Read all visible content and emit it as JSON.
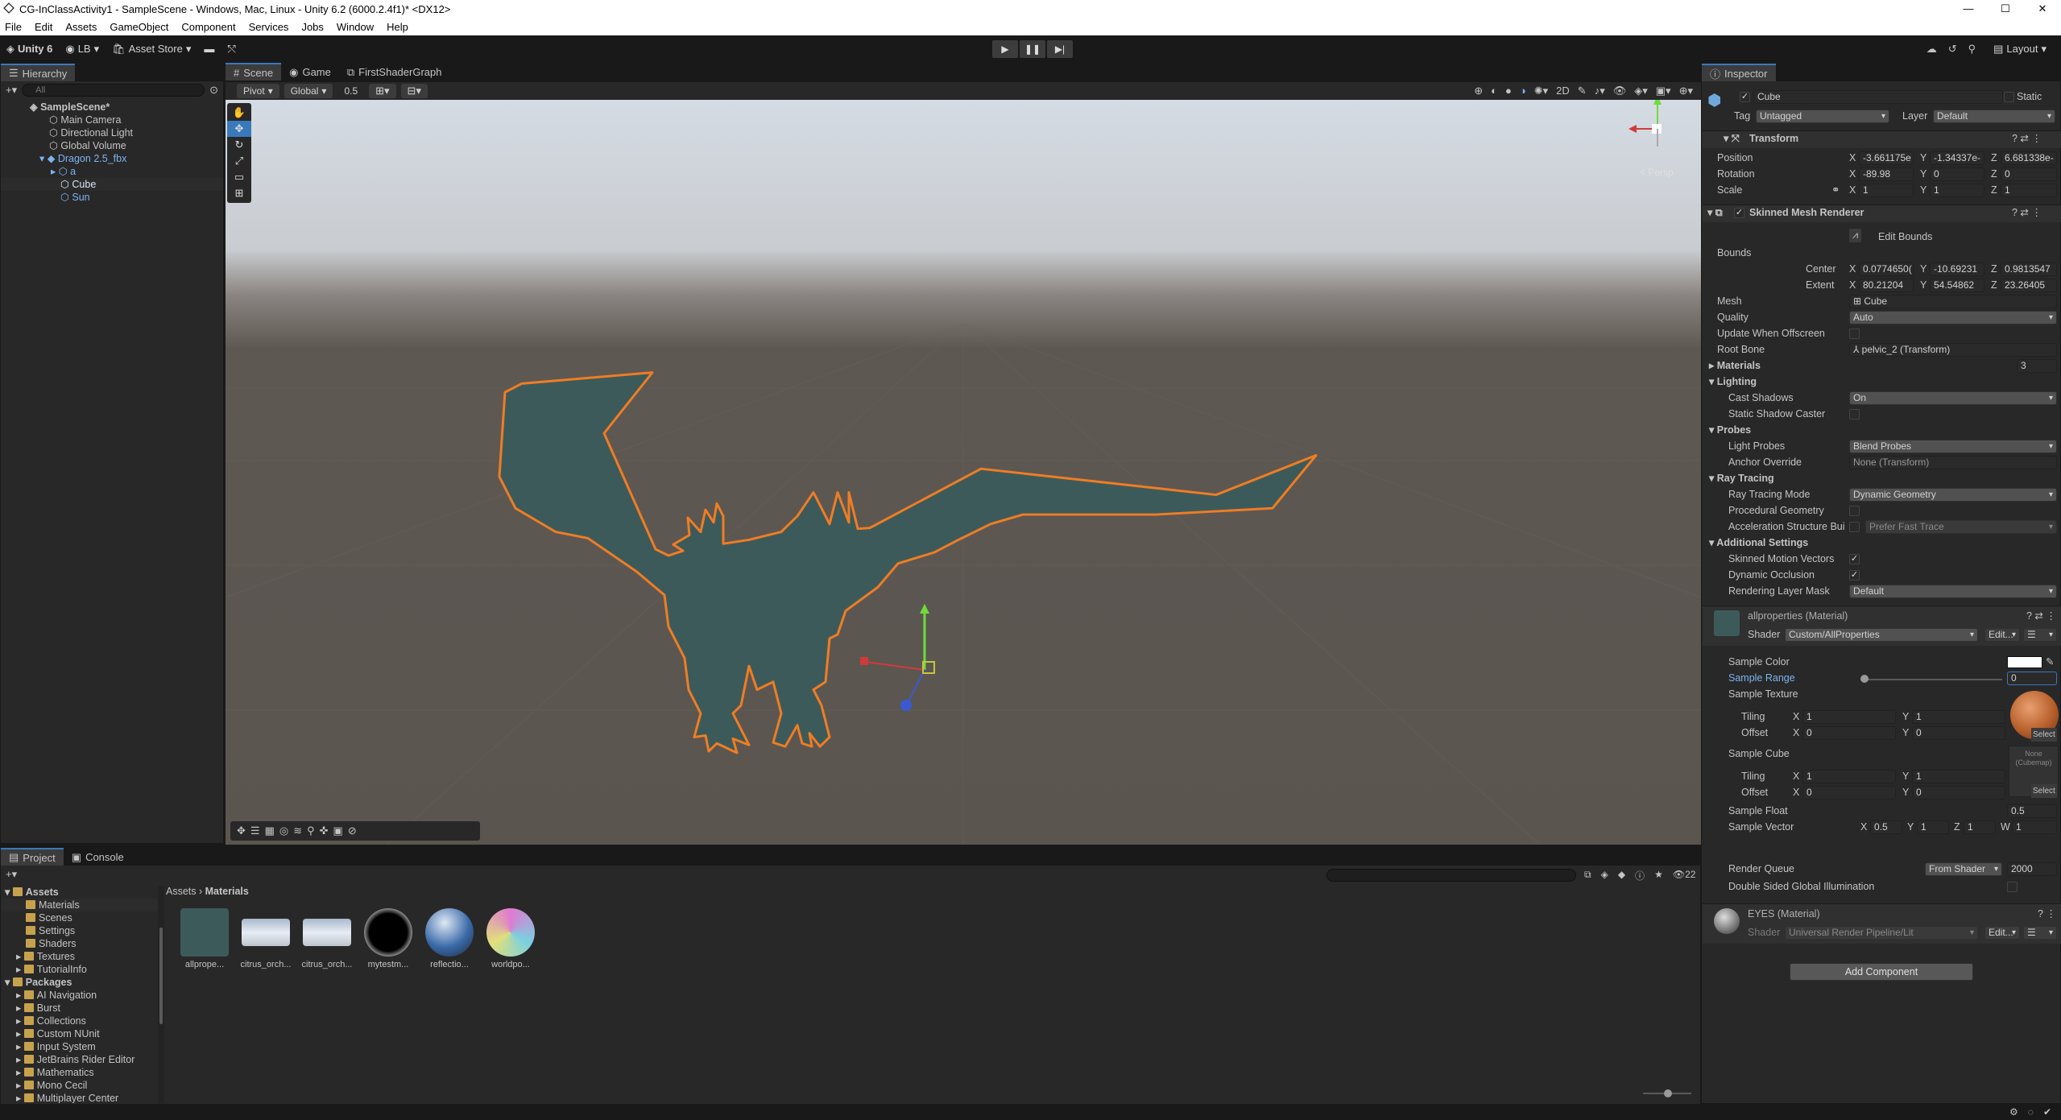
{
  "window": {
    "title": "CG-InClassActivity1 - SampleScene - Windows, Mac, Linux - Unity 6.2 (6000.2.4f1)* <DX12>",
    "controls": [
      "—",
      "☐",
      "✕"
    ]
  },
  "menu": [
    "File",
    "Edit",
    "Assets",
    "GameObject",
    "Component",
    "Services",
    "Jobs",
    "Window",
    "Help"
  ],
  "toolbar": {
    "unity": "Unity 6",
    "account": "LB",
    "asset_store": "Asset Store",
    "layout": "Layout"
  },
  "hierarchy": {
    "tab": "Hierarchy",
    "search_placeholder": "All",
    "items": [
      {
        "label": "SampleScene*",
        "indent": 0
      },
      {
        "label": "Main Camera",
        "indent": 1
      },
      {
        "label": "Directional Light",
        "indent": 1
      },
      {
        "label": "Global Volume",
        "indent": 1
      },
      {
        "label": "Dragon 2.5_fbx",
        "indent": 1
      },
      {
        "label": "a",
        "indent": 2
      },
      {
        "label": "Cube",
        "indent": 2
      },
      {
        "label": "Sun",
        "indent": 2
      }
    ]
  },
  "scene_tabs": [
    "Scene",
    "Game",
    "FirstShaderGraph"
  ],
  "scene_toolbar": {
    "pivot": "Pivot",
    "global": "Global",
    "snap": "0.5"
  },
  "gizmo_label": "< Persp",
  "inspector": {
    "tab": "Inspector",
    "object_name": "Cube",
    "static_label": "Static",
    "tag_label": "Tag",
    "tag_value": "Untagged",
    "layer_label": "Layer",
    "layer_value": "Default",
    "transform": {
      "title": "Transform",
      "position": {
        "label": "Position",
        "x": "-3.661175e",
        "y": "-1.34337e-",
        "z": "6.681338e-"
      },
      "rotation": {
        "label": "Rotation",
        "x": "-89.98",
        "y": "0",
        "z": "0"
      },
      "scale": {
        "label": "Scale",
        "x": "1",
        "y": "1",
        "z": "1"
      }
    },
    "smr": {
      "title": "Skinned Mesh Renderer",
      "edit_bounds": "Edit Bounds",
      "bounds": "Bounds",
      "center": {
        "label": "Center",
        "x": "0.0774650(",
        "y": "-10.69231",
        "z": "0.9813547"
      },
      "extent": {
        "label": "Extent",
        "x": "80.21204",
        "y": "54.54862",
        "z": "23.26405"
      },
      "mesh_label": "Mesh",
      "mesh_value": "Cube",
      "quality_label": "Quality",
      "quality_value": "Auto",
      "offscreen_label": "Update When Offscreen",
      "rootbone_label": "Root Bone",
      "rootbone_value": "pelvic_2 (Transform)",
      "materials_label": "Materials",
      "materials_count": "3",
      "lighting": "Lighting",
      "cast_shadows_label": "Cast Shadows",
      "cast_shadows_value": "On",
      "static_caster_label": "Static Shadow Caster",
      "probes": "Probes",
      "light_probes_label": "Light Probes",
      "light_probes_value": "Blend Probes",
      "anchor_label": "Anchor Override",
      "anchor_value": "None (Transform)",
      "raytracing": "Ray Tracing",
      "rt_mode_label": "Ray Tracing Mode",
      "rt_mode_value": "Dynamic Geometry",
      "proc_geom_label": "Procedural Geometry",
      "accel_label": "Acceleration Structure Bui",
      "accel_value": "Prefer Fast Trace",
      "additional": "Additional Settings",
      "motion_label": "Skinned Motion Vectors",
      "occlusion_label": "Dynamic Occlusion",
      "rlm_label": "Rendering Layer Mask",
      "rlm_value": "Default"
    },
    "material": {
      "title": "allproperties (Material)",
      "shader_label": "Shader",
      "shader_value": "Custom/AllProperties",
      "edit": "Edit...",
      "sample_color": "Sample Color",
      "sample_range": "Sample Range",
      "sample_range_value": "0",
      "sample_texture": "Sample Texture",
      "tiling": "Tiling",
      "offset": "Offset",
      "tex_tiling_x": "1",
      "tex_tiling_y": "1",
      "tex_offset_x": "0",
      "tex_offset_y": "0",
      "select": "Select",
      "sample_cube": "Sample Cube",
      "cube_none": "None (Cubemap)",
      "cube_tiling_x": "1",
      "cube_tiling_y": "1",
      "cube_offset_x": "0",
      "cube_offset_y": "0",
      "sample_float": "Sample Float",
      "sample_float_value": "0.5",
      "sample_vector": "Sample Vector",
      "vx": "0.5",
      "vy": "1",
      "vz": "1",
      "vw": "1",
      "render_queue": "Render Queue",
      "rq_mode": "From Shader",
      "rq_value": "2000",
      "dsgi": "Double Sided Global Illumination"
    },
    "eyes": {
      "title": "EYES (Material)",
      "shader_label": "Shader",
      "shader_value": "Universal Render Pipeline/Lit",
      "edit": "Edit..."
    },
    "add_component": "Add Component"
  },
  "project": {
    "tabs": [
      "Project",
      "Console"
    ],
    "breadcrumb": [
      "Assets",
      "Materials"
    ],
    "count": "22",
    "tree": [
      {
        "label": "Assets",
        "indent": 0,
        "bold": true
      },
      {
        "label": "Materials",
        "indent": 1
      },
      {
        "label": "Scenes",
        "indent": 1
      },
      {
        "label": "Settings",
        "indent": 1
      },
      {
        "label": "Shaders",
        "indent": 1
      },
      {
        "label": "Textures",
        "indent": 1
      },
      {
        "label": "TutorialInfo",
        "indent": 1
      },
      {
        "label": "Packages",
        "indent": 0,
        "bold": true
      },
      {
        "label": "AI Navigation",
        "indent": 1
      },
      {
        "label": "Burst",
        "indent": 1
      },
      {
        "label": "Collections",
        "indent": 1
      },
      {
        "label": "Custom NUnit",
        "indent": 1
      },
      {
        "label": "Input System",
        "indent": 1
      },
      {
        "label": "JetBrains Rider Editor",
        "indent": 1
      },
      {
        "label": "Mathematics",
        "indent": 1
      },
      {
        "label": "Mono Cecil",
        "indent": 1
      },
      {
        "label": "Multiplayer Center",
        "indent": 1
      }
    ],
    "assets": [
      {
        "name": "allprope...",
        "color": "#3d5a5a"
      },
      {
        "name": "citrus_orch...",
        "color": "#c9d6e6"
      },
      {
        "name": "citrus_orch...",
        "color": "#c9d6e6"
      },
      {
        "name": "mytestm...",
        "color": "#111111"
      },
      {
        "name": "reflectio...",
        "color": "#3a6aa8"
      },
      {
        "name": "worldpo...",
        "color": "#e07ad0"
      }
    ]
  },
  "colors": {
    "accent": "#3a79bb",
    "selection_outline": "#f07d23",
    "dragon": "#3d5a5a"
  }
}
